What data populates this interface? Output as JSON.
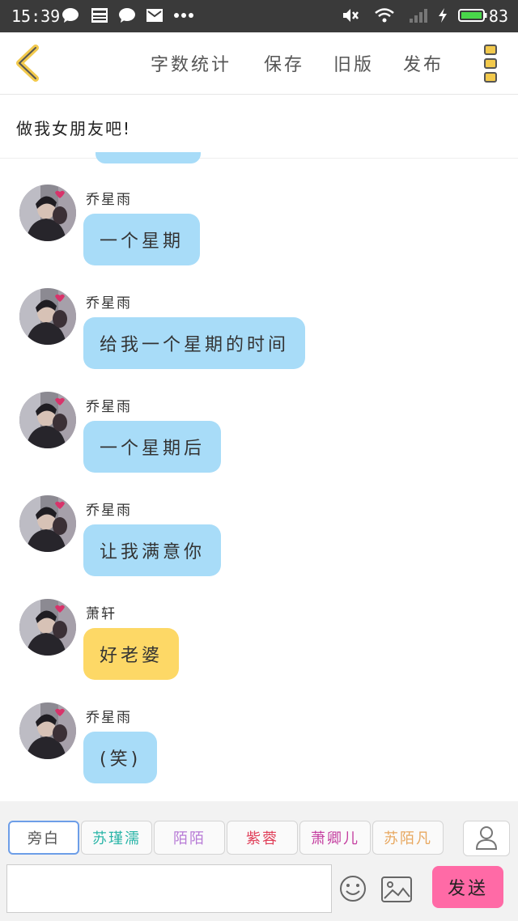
{
  "status_bar": {
    "time": "15:39",
    "battery": "83"
  },
  "toolbar": {
    "items": [
      "字数统计",
      "保存",
      "旧版",
      "发布"
    ]
  },
  "chat_title": "做我女朋友吧!",
  "messages": [
    {
      "name": "乔星雨",
      "text": "一个星期",
      "color": "blue"
    },
    {
      "name": "乔星雨",
      "text": "给我一个星期的时间",
      "color": "blue"
    },
    {
      "name": "乔星雨",
      "text": "一个星期后",
      "color": "blue"
    },
    {
      "name": "乔星雨",
      "text": "让我满意你",
      "color": "blue"
    },
    {
      "name": "萧轩",
      "text": "好老婆",
      "color": "yellow"
    },
    {
      "name": "乔星雨",
      "text": "(笑)",
      "color": "blue"
    }
  ],
  "characters": [
    {
      "name": "旁白",
      "color": "#555555"
    },
    {
      "name": "苏瑾濡",
      "color": "#2bb5a8"
    },
    {
      "name": "陌陌",
      "color": "#b77ad6"
    },
    {
      "name": "紫蓉",
      "color": "#e0405a"
    },
    {
      "name": "萧卿儿",
      "color": "#c43fa0"
    },
    {
      "name": "苏陌凡",
      "color": "#e8a860"
    }
  ],
  "composer": {
    "input_value": "",
    "send_label": "发送"
  },
  "colors": {
    "bubble_blue": "#a8dcf8",
    "bubble_yellow": "#fdd866",
    "send": "#ff6aa6",
    "accent_back": "#f2c94c"
  }
}
